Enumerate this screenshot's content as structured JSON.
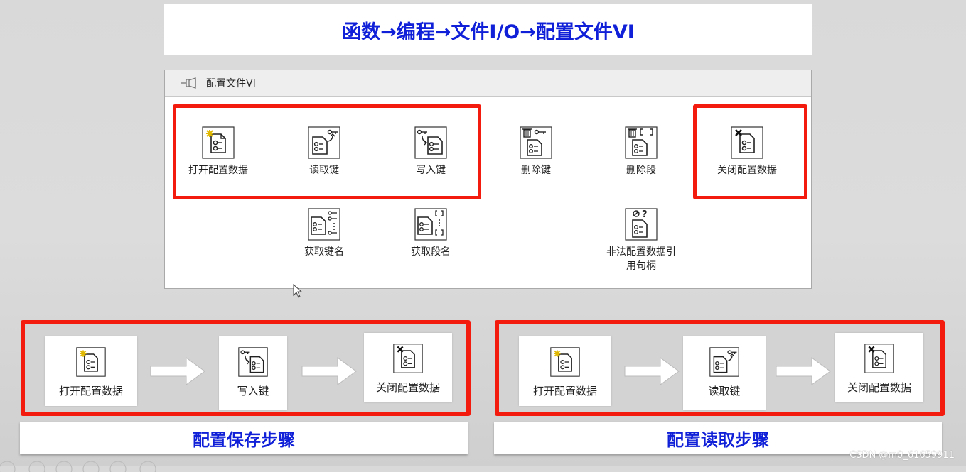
{
  "title": "函数→编程→文件I/O→配置文件VI",
  "palette": {
    "title": "配置文件VI",
    "items": [
      {
        "label": "打开配置数据",
        "icon": "open-config-icon"
      },
      {
        "label": "读取键",
        "icon": "read-key-icon"
      },
      {
        "label": "写入键",
        "icon": "write-key-icon"
      },
      {
        "label": "删除键",
        "icon": "delete-key-icon"
      },
      {
        "label": "删除段",
        "icon": "delete-section-icon"
      },
      {
        "label": "关闭配置数据",
        "icon": "close-config-icon"
      },
      {
        "label": "获取键名",
        "icon": "get-key-names-icon"
      },
      {
        "label": "获取段名",
        "icon": "get-section-names-icon"
      },
      {
        "label": "非法配置数据引用句柄",
        "line1": "非法配置数据引",
        "line2": "用句柄",
        "icon": "invalid-refnum-icon"
      }
    ]
  },
  "save_flow": {
    "caption": "配置保存步骤",
    "steps": [
      "打开配置数据",
      "写入键",
      "关闭配置数据"
    ]
  },
  "read_flow": {
    "caption": "配置读取步骤",
    "steps": [
      "打开配置数据",
      "读取键",
      "关闭配置数据"
    ]
  },
  "watermark": "CSDN @m0_61659911",
  "colors": {
    "title_blue": "#1020d8",
    "highlight_red": "#f21b0d"
  }
}
